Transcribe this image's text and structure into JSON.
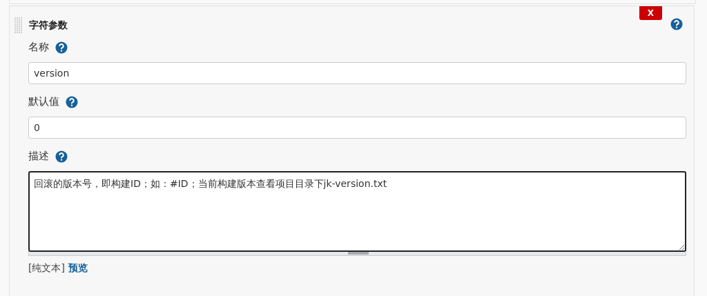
{
  "panel": {
    "title": "字符参数",
    "delete_button": "X",
    "fields": [
      {
        "kind": "input",
        "label": "名称",
        "value": "version"
      },
      {
        "kind": "input",
        "label": "默认值",
        "value": "0"
      },
      {
        "kind": "textarea",
        "label": "描述",
        "value": "回滚的版本号，即构建ID；如：#ID；当前构建版本查看项目目录下jk-version.txt"
      }
    ],
    "format": {
      "current": "[纯文本]",
      "link": "预览"
    }
  }
}
